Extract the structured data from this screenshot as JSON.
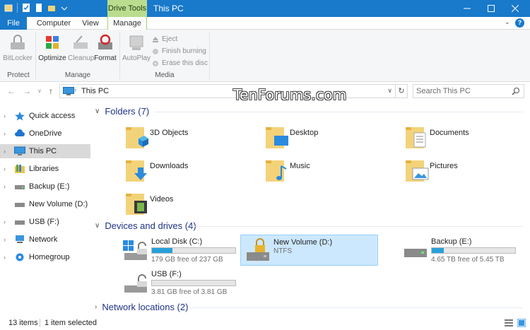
{
  "window": {
    "title": "This PC",
    "context_tab": "Drive Tools"
  },
  "tabs": [
    "File",
    "Computer",
    "View",
    "Manage"
  ],
  "ribbon": {
    "protect": {
      "label": "Protect",
      "bitlocker": "BitLocker"
    },
    "manage": {
      "label": "Manage",
      "optimize": "Optimize",
      "cleanup": "Cleanup",
      "format": "Format"
    },
    "media": {
      "label": "Media",
      "autoplay": "AutoPlay",
      "eject": "Eject",
      "finish_burning": "Finish burning",
      "erase": "Erase this disc"
    }
  },
  "address": {
    "path": "This PC",
    "search_placeholder": "Search This PC"
  },
  "watermark": "TenForums.com",
  "nav_pane": [
    {
      "label": "Quick access",
      "icon": "star-icon"
    },
    {
      "label": "OneDrive",
      "icon": "cloud-icon"
    },
    {
      "label": "This PC",
      "icon": "monitor-icon",
      "selected": true
    },
    {
      "label": "Libraries",
      "icon": "library-icon"
    },
    {
      "label": "Backup (E:)",
      "icon": "drive-icon"
    },
    {
      "label": "New Volume (D:)",
      "icon": "drive-icon"
    },
    {
      "label": "USB (F:)",
      "icon": "usb-drive-icon"
    },
    {
      "label": "Network",
      "icon": "network-icon"
    },
    {
      "label": "Homegroup",
      "icon": "homegroup-icon"
    }
  ],
  "sections": {
    "folders": "Folders (7)",
    "devices": "Devices and drives (4)",
    "network": "Network locations (2)"
  },
  "folders": [
    {
      "name": "3D Objects"
    },
    {
      "name": "Desktop"
    },
    {
      "name": "Documents"
    },
    {
      "name": "Downloads"
    },
    {
      "name": "Music"
    },
    {
      "name": "Pictures"
    },
    {
      "name": "Videos"
    }
  ],
  "drives": [
    {
      "name": "Local Disk (C:)",
      "info": "179 GB free of 237 GB",
      "used_fraction": 0.245
    },
    {
      "name": "New Volume (D:)",
      "info": "NTFS",
      "selected": true
    },
    {
      "name": "Backup (E:)",
      "info": "4.65 TB free of 5.45 TB",
      "used_fraction": 0.147
    },
    {
      "name": "USB (F:)",
      "info": "3.81 GB free of 3.81 GB",
      "used_fraction": 0.0
    }
  ],
  "status": {
    "items": "13 items",
    "selected": "1 item selected"
  },
  "colors": {
    "titlebar": "#1979ca",
    "context_tab": "#b9dc8e",
    "section_header": "#1e3287",
    "drive_bar": "#26a0da",
    "selection": "#cce8ff"
  }
}
